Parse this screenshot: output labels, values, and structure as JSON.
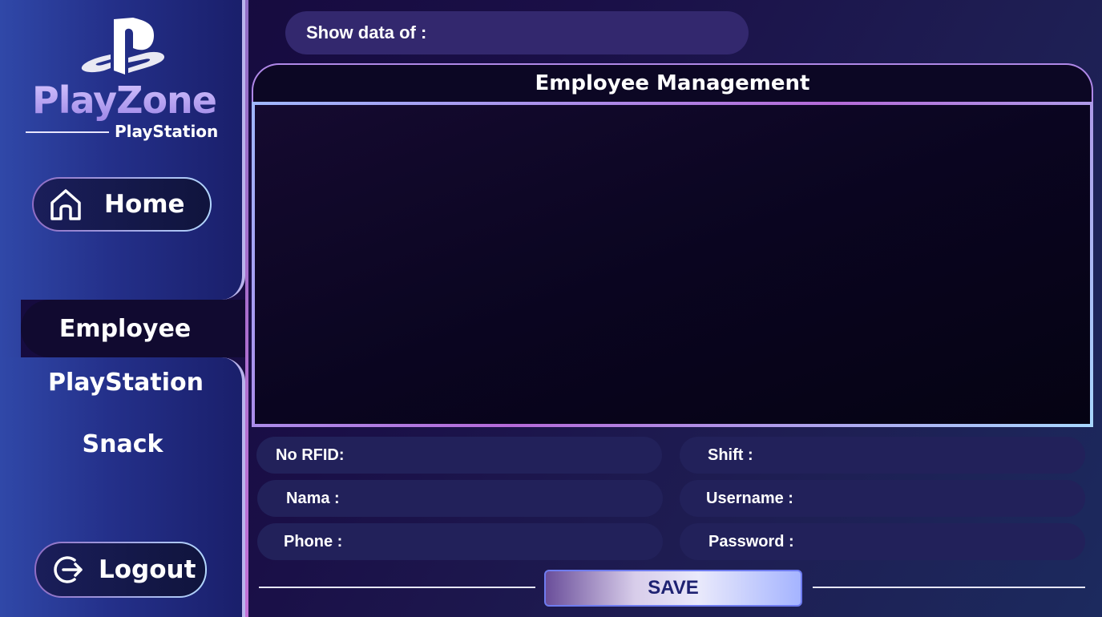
{
  "brand": {
    "name": "PlayZone",
    "subtitle": "PlayStation"
  },
  "sidebar": {
    "home_label": "Home",
    "active_label": "Employee",
    "items": [
      {
        "label": "PlayStation"
      },
      {
        "label": "Snack"
      }
    ],
    "logout_label": "Logout"
  },
  "header": {
    "show_data_label": "Show data of :"
  },
  "panel": {
    "title": "Employee Management"
  },
  "form": {
    "rfid_label": "No RFID:",
    "nama_label": "Nama :",
    "phone_label": "Phone :",
    "shift_label": "Shift :",
    "username_label": "Username :",
    "password_label": "Password :",
    "save_label": "SAVE"
  },
  "icons": {
    "brand": "playstation-logo-icon",
    "home": "home-icon",
    "logout": "logout-icon"
  },
  "colors": {
    "accent": "#b46ad8",
    "sidebar": "#24308a",
    "field": "#22215a",
    "background": "#14093a"
  }
}
